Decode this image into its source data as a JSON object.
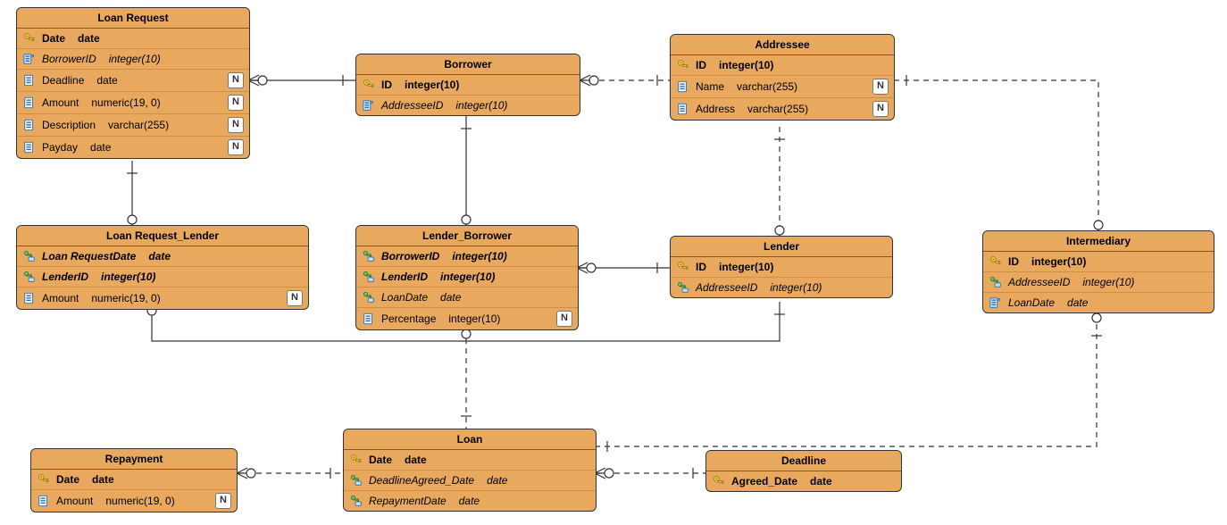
{
  "entities": {
    "loan_request": {
      "title": "Loan Request",
      "cols": [
        {
          "icon": "pk",
          "name": "Date",
          "type": "date",
          "bold": true,
          "n": false
        },
        {
          "icon": "fk",
          "name": "BorrowerID",
          "type": "integer(10)",
          "italic": true,
          "n": false
        },
        {
          "icon": "col",
          "name": "Deadline",
          "type": "date",
          "n": true
        },
        {
          "icon": "col",
          "name": "Amount",
          "type": "numeric(19, 0)",
          "n": true
        },
        {
          "icon": "col",
          "name": "Description",
          "type": "varchar(255)",
          "n": true
        },
        {
          "icon": "col",
          "name": "Payday",
          "type": "date",
          "n": true
        }
      ]
    },
    "borrower": {
      "title": "Borrower",
      "cols": [
        {
          "icon": "pk",
          "name": "ID",
          "type": "integer(10)",
          "bold": true,
          "n": false
        },
        {
          "icon": "fk",
          "name": "AddresseeID",
          "type": "integer(10)",
          "italic": true,
          "n": false
        }
      ]
    },
    "addressee": {
      "title": "Addressee",
      "cols": [
        {
          "icon": "pk",
          "name": "ID",
          "type": "integer(10)",
          "bold": true,
          "n": false
        },
        {
          "icon": "col",
          "name": "Name",
          "type": "varchar(255)",
          "n": true
        },
        {
          "icon": "col",
          "name": "Address",
          "type": "varchar(255)",
          "n": true
        }
      ]
    },
    "loan_request_lender": {
      "title": "Loan Request_Lender",
      "cols": [
        {
          "icon": "pfk",
          "name": "Loan RequestDate",
          "type": "date",
          "bold": true,
          "italic": true,
          "n": false
        },
        {
          "icon": "pfk",
          "name": "LenderID",
          "type": "integer(10)",
          "bold": true,
          "italic": true,
          "n": false
        },
        {
          "icon": "col",
          "name": "Amount",
          "type": "numeric(19, 0)",
          "n": true
        }
      ]
    },
    "lender_borrower": {
      "title": "Lender_Borrower",
      "cols": [
        {
          "icon": "pfk",
          "name": "BorrowerID",
          "type": "integer(10)",
          "bold": true,
          "italic": true,
          "n": false
        },
        {
          "icon": "pfk",
          "name": "LenderID",
          "type": "integer(10)",
          "bold": true,
          "italic": true,
          "n": false
        },
        {
          "icon": "pfk",
          "name": "LoanDate",
          "type": "date",
          "italic": true,
          "n": false
        },
        {
          "icon": "col",
          "name": "Percentage",
          "type": "integer(10)",
          "n": true
        }
      ]
    },
    "lender": {
      "title": "Lender",
      "cols": [
        {
          "icon": "pk",
          "name": "ID",
          "type": "integer(10)",
          "bold": true,
          "n": false
        },
        {
          "icon": "pfk",
          "name": "AddresseeID",
          "type": "integer(10)",
          "italic": true,
          "n": false
        }
      ]
    },
    "intermediary": {
      "title": "Intermediary",
      "cols": [
        {
          "icon": "pk",
          "name": "ID",
          "type": "integer(10)",
          "bold": true,
          "n": false
        },
        {
          "icon": "pfk",
          "name": "AddresseeID",
          "type": "integer(10)",
          "italic": true,
          "n": false
        },
        {
          "icon": "fk",
          "name": "LoanDate",
          "type": "date",
          "italic": true,
          "n": false
        }
      ]
    },
    "loan": {
      "title": "Loan",
      "cols": [
        {
          "icon": "pk",
          "name": "Date",
          "type": "date",
          "bold": true,
          "n": false
        },
        {
          "icon": "pfk",
          "name": "DeadlineAgreed_Date",
          "type": "date",
          "italic": true,
          "n": false
        },
        {
          "icon": "pfk",
          "name": "RepaymentDate",
          "type": "date",
          "italic": true,
          "n": false
        }
      ]
    },
    "deadline": {
      "title": "Deadline",
      "cols": [
        {
          "icon": "pk",
          "name": "Agreed_Date",
          "type": "date",
          "bold": true,
          "n": false
        }
      ]
    },
    "repayment": {
      "title": "Repayment",
      "cols": [
        {
          "icon": "pk",
          "name": "Date",
          "type": "date",
          "bold": true,
          "n": false
        },
        {
          "icon": "col",
          "name": "Amount",
          "type": "numeric(19, 0)",
          "n": true
        }
      ]
    }
  },
  "icons": {
    "pk": "key-icon",
    "fk": "foreign-key-icon",
    "pfk": "pk-fk-icon",
    "col": "column-icon"
  }
}
